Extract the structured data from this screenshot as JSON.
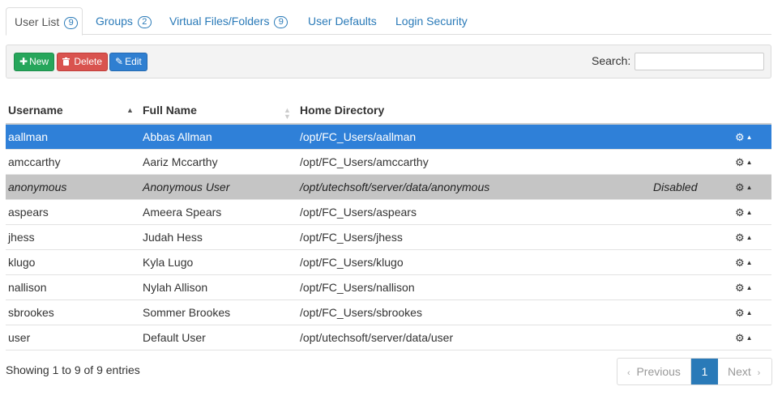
{
  "tabs": [
    {
      "label": "User List",
      "badge": "9"
    },
    {
      "label": "Groups",
      "badge": "2"
    },
    {
      "label": "Virtual Files/Folders",
      "badge": "9"
    },
    {
      "label": "User Defaults"
    },
    {
      "label": "Login Security"
    }
  ],
  "toolbar": {
    "new_label": "New",
    "delete_label": "Delete",
    "edit_label": "Edit",
    "search_label": "Search:",
    "search_value": ""
  },
  "table": {
    "columns": [
      "Username",
      "Full Name",
      "Home Directory"
    ],
    "rows": [
      {
        "username": "aallman",
        "full_name": "Abbas Allman",
        "home": "/opt/FC_Users/aallman",
        "status": "",
        "state": "selected"
      },
      {
        "username": "amccarthy",
        "full_name": "Aariz Mccarthy",
        "home": "/opt/FC_Users/amccarthy",
        "status": "",
        "state": "normal"
      },
      {
        "username": "anonymous",
        "full_name": "Anonymous User",
        "home": "/opt/utechsoft/server/data/anonymous",
        "status": "Disabled",
        "state": "disabled"
      },
      {
        "username": "aspears",
        "full_name": "Ameera Spears",
        "home": "/opt/FC_Users/aspears",
        "status": "",
        "state": "normal"
      },
      {
        "username": "jhess",
        "full_name": "Judah Hess",
        "home": "/opt/FC_Users/jhess",
        "status": "",
        "state": "normal"
      },
      {
        "username": "klugo",
        "full_name": "Kyla Lugo",
        "home": "/opt/FC_Users/klugo",
        "status": "",
        "state": "normal"
      },
      {
        "username": "nallison",
        "full_name": "Nylah Allison",
        "home": "/opt/FC_Users/nallison",
        "status": "",
        "state": "normal"
      },
      {
        "username": "sbrookes",
        "full_name": "Sommer Brookes",
        "home": "/opt/FC_Users/sbrookes",
        "status": "",
        "state": "normal"
      },
      {
        "username": "user",
        "full_name": "Default User",
        "home": "/opt/utechsoft/server/data/user",
        "status": "",
        "state": "normal"
      }
    ]
  },
  "footer": {
    "info": "Showing 1 to 9 of 9 entries",
    "previous": "Previous",
    "current_page": "1",
    "next": "Next"
  },
  "colors": {
    "accent": "#2a7ab8",
    "selected_row": "#2f80d8",
    "disabled_row": "#c5c5c5",
    "new_button": "#26a65b",
    "delete_button": "#d9534f",
    "edit_button": "#2f7fd1"
  },
  "icons": {
    "new": "plus-icon",
    "delete": "trash-icon",
    "edit": "pencil-icon",
    "row_action": "gear-icon"
  }
}
